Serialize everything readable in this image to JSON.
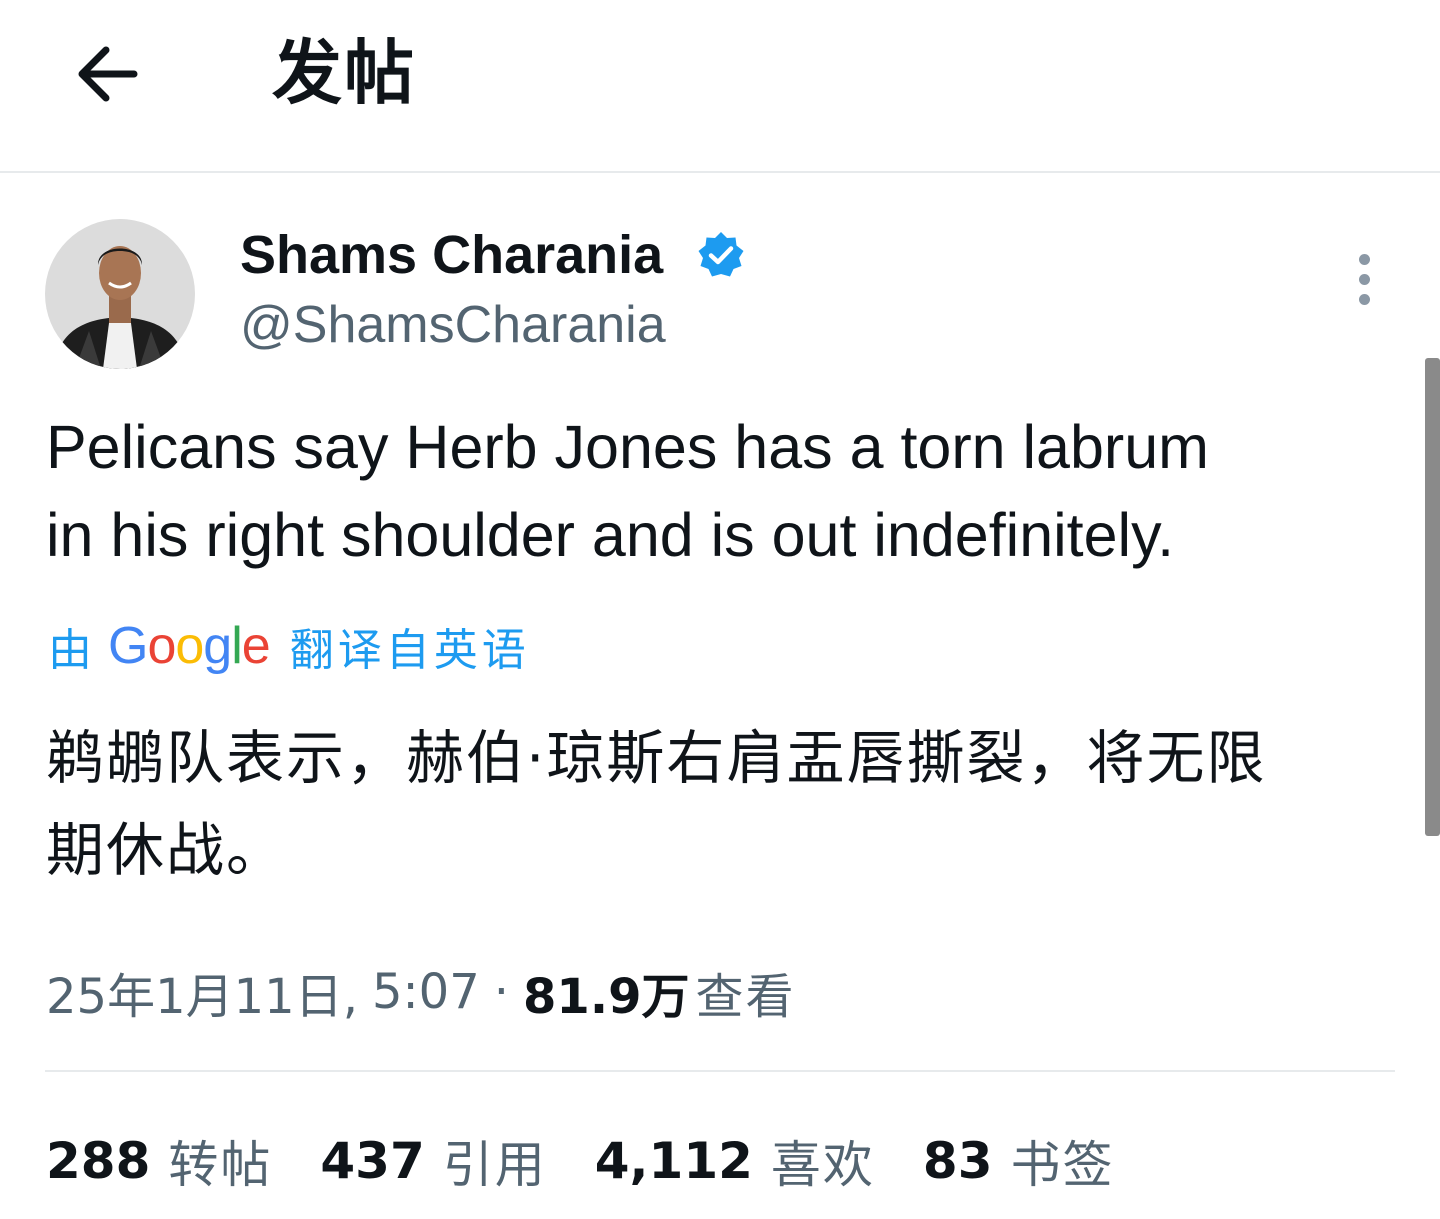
{
  "header": {
    "title": "发帖",
    "back_icon": "arrow-left-icon"
  },
  "tweet": {
    "author": {
      "display_name": "Shams Charania",
      "handle": "@ShamsCharania",
      "verified": true,
      "verified_color": "#1d9bf0"
    },
    "text_lines": [
      "Pelicans say Herb Jones has a torn labrum",
      "in his right shoulder and is out indefinitely."
    ],
    "translation": {
      "by_label": "由",
      "provider": "Google",
      "label": "翻译自英语",
      "text_lines": [
        "鹈鹕队表示，赫伯·琼斯右肩盂唇撕裂，将无限",
        "期休战。"
      ]
    },
    "meta": {
      "date": "25年1月11日,",
      "time": "5:07",
      "separator": "·",
      "views_count": "81.9万",
      "views_label": "查看"
    },
    "stats": [
      {
        "count": "288",
        "label": "转帖"
      },
      {
        "count": "437",
        "label": "引用"
      },
      {
        "count": "4,112",
        "label": "喜欢"
      },
      {
        "count": "83",
        "label": "书签"
      }
    ]
  },
  "colors": {
    "accent": "#1d9bf0",
    "text_primary": "#0f1419",
    "text_secondary": "#536471",
    "divider": "#e7eaec"
  },
  "icons": {
    "back": "arrow-left-icon",
    "verified": "verified-badge-icon",
    "more": "more-vertical-icon"
  }
}
